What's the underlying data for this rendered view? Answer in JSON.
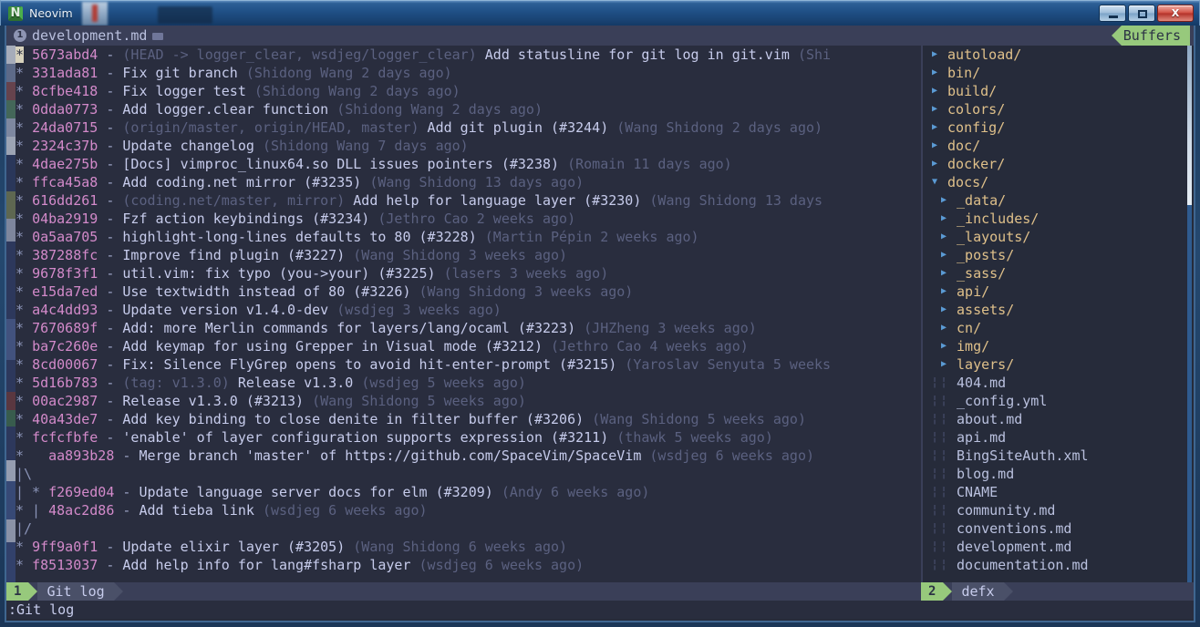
{
  "window": {
    "app_title": "Neovim",
    "app_icon": "neovim-logo-icon",
    "minimize_label": "minimize-icon",
    "maximize_label": "maximize-icon",
    "close_label": "X"
  },
  "tabline": {
    "tab_number": "1",
    "tab_name": "development.md",
    "modified_indicator": "modified-icon",
    "right_label": "Buffers"
  },
  "editor": {
    "lines": [
      {
        "graph": "* ",
        "hash": "5673abd4",
        "dash": " - ",
        "refs": "(HEAD -> logger_clear, wsdjeg/logger_clear) ",
        "subject": "Add statusline for git log in git.vim ",
        "meta": "(Shi",
        "cursor": true
      },
      {
        "graph": "* ",
        "hash": "331ada81",
        "dash": " - ",
        "refs": "",
        "subject": "Fix git branch ",
        "meta": "(Shidong Wang 2 days ago)"
      },
      {
        "graph": "* ",
        "hash": "8cfbe418",
        "dash": " - ",
        "refs": "",
        "subject": "Fix logger test ",
        "meta": "(Shidong Wang 2 days ago)"
      },
      {
        "graph": "* ",
        "hash": "0dda0773",
        "dash": " - ",
        "refs": "",
        "subject": "Add logger.clear function ",
        "meta": "(Shidong Wang 2 days ago)"
      },
      {
        "graph": "* ",
        "hash": "24da0715",
        "dash": " - ",
        "refs": "(origin/master, origin/HEAD, master) ",
        "subject": "Add git plugin (#3244) ",
        "meta": "(Wang Shidong 2 days ago)"
      },
      {
        "graph": "* ",
        "hash": "2324c37b",
        "dash": " - ",
        "refs": "",
        "subject": "Update changelog ",
        "meta": "(Shidong Wang 7 days ago)"
      },
      {
        "graph": "* ",
        "hash": "4dae275b",
        "dash": " - ",
        "refs": "",
        "subject": "[Docs] vimproc_linux64.so DLL issues pointers (#3238) ",
        "meta": "(Romain 11 days ago)"
      },
      {
        "graph": "* ",
        "hash": "ffca45a8",
        "dash": " - ",
        "refs": "",
        "subject": "Add coding.net mirror (#3235) ",
        "meta": "(Wang Shidong 13 days ago)"
      },
      {
        "graph": "* ",
        "hash": "616dd261",
        "dash": " - ",
        "refs": "(coding.net/master, mirror) ",
        "subject": "Add help for language layer (#3230) ",
        "meta": "(Wang Shidong 13 days"
      },
      {
        "graph": "* ",
        "hash": "04ba2919",
        "dash": " - ",
        "refs": "",
        "subject": "Fzf action keybindings (#3234) ",
        "meta": "(Jethro Cao 2 weeks ago)"
      },
      {
        "graph": "* ",
        "hash": "0a5aa705",
        "dash": " - ",
        "refs": "",
        "subject": "highlight-long-lines defaults to 80 (#3228) ",
        "meta": "(Martin Pépin 2 weeks ago)"
      },
      {
        "graph": "* ",
        "hash": "387288fc",
        "dash": " - ",
        "refs": "",
        "subject": "Improve find plugin (#3227) ",
        "meta": "(Wang Shidong 3 weeks ago)"
      },
      {
        "graph": "* ",
        "hash": "9678f3f1",
        "dash": " - ",
        "refs": "",
        "subject": "util.vim: fix typo (you->your) (#3225) ",
        "meta": "(lasers 3 weeks ago)"
      },
      {
        "graph": "* ",
        "hash": "e15da7ed",
        "dash": " - ",
        "refs": "",
        "subject": "Use textwidth instead of 80 (#3226) ",
        "meta": "(Wang Shidong 3 weeks ago)"
      },
      {
        "graph": "* ",
        "hash": "a4c4dd93",
        "dash": " - ",
        "refs": "",
        "subject": "Update version v1.4.0-dev ",
        "meta": "(wsdjeg 3 weeks ago)"
      },
      {
        "graph": "* ",
        "hash": "7670689f",
        "dash": " - ",
        "refs": "",
        "subject": "Add: more Merlin commands for layers/lang/ocaml (#3223) ",
        "meta": "(JHZheng 3 weeks ago)"
      },
      {
        "graph": "* ",
        "hash": "ba7c260e",
        "dash": " - ",
        "refs": "",
        "subject": "Add keymap for using Grepper in Visual mode (#3212) ",
        "meta": "(Jethro Cao 4 weeks ago)"
      },
      {
        "graph": "* ",
        "hash": "8cd00067",
        "dash": " - ",
        "refs": "",
        "subject": "Fix: Silence FlyGrep opens to avoid hit-enter-prompt (#3215) ",
        "meta": "(Yaroslav Senyuta 5 weeks"
      },
      {
        "graph": "* ",
        "hash": "5d16b783",
        "dash": " - ",
        "refs": "(tag: v1.3.0) ",
        "subject": "Release v1.3.0 ",
        "meta": "(wsdjeg 5 weeks ago)"
      },
      {
        "graph": "* ",
        "hash": "00ac2987",
        "dash": " - ",
        "refs": "",
        "subject": "Release v1.3.0 (#3213) ",
        "meta": "(Wang Shidong 5 weeks ago)"
      },
      {
        "graph": "* ",
        "hash": "40a43de7",
        "dash": " - ",
        "refs": "",
        "subject": "Add key binding to close denite in filter buffer (#3206) ",
        "meta": "(Wang Shidong 5 weeks ago)"
      },
      {
        "graph": "* ",
        "hash": "fcfcfbfe",
        "dash": " - ",
        "refs": "",
        "subject": "'enable' of layer configuration supports expression (#3211) ",
        "meta": "(thawk 5 weeks ago)"
      },
      {
        "graph": "*   ",
        "hash": "aa893b28",
        "dash": " - ",
        "refs": "",
        "subject": "Merge branch 'master' of https://github.com/SpaceVim/SpaceVim ",
        "meta": "(wsdjeg 6 weeks ago)"
      },
      {
        "graph": "|\\",
        "hash": "",
        "dash": "",
        "refs": "",
        "subject": "",
        "meta": ""
      },
      {
        "graph": "| * ",
        "hash": "f269ed04",
        "dash": " - ",
        "refs": "",
        "subject": "Update language server docs for elm (#3209) ",
        "meta": "(Andy 6 weeks ago)"
      },
      {
        "graph": "* | ",
        "hash": "48ac2d86",
        "dash": " - ",
        "refs": "",
        "subject": "Add tieba link ",
        "meta": "(wsdjeg 6 weeks ago)"
      },
      {
        "graph": "|/",
        "hash": "",
        "dash": "",
        "refs": "",
        "subject": "",
        "meta": ""
      },
      {
        "graph": "* ",
        "hash": "9ff9a0f1",
        "dash": " - ",
        "refs": "",
        "subject": "Update elixir layer (#3205) ",
        "meta": "(Wang Shidong 6 weeks ago)"
      },
      {
        "graph": "* ",
        "hash": "f8513037",
        "dash": " - ",
        "refs": "",
        "subject": "Add help info for lang#fsharp layer ",
        "meta": "(wsdjeg 6 weeks ago)"
      }
    ]
  },
  "filetree": {
    "items": [
      {
        "indent": 0,
        "type": "dir",
        "state": "closed",
        "name": "autoload/"
      },
      {
        "indent": 0,
        "type": "dir",
        "state": "closed",
        "name": "bin/"
      },
      {
        "indent": 0,
        "type": "dir",
        "state": "closed",
        "name": "build/"
      },
      {
        "indent": 0,
        "type": "dir",
        "state": "closed",
        "name": "colors/"
      },
      {
        "indent": 0,
        "type": "dir",
        "state": "closed",
        "name": "config/"
      },
      {
        "indent": 0,
        "type": "dir",
        "state": "closed",
        "name": "doc/"
      },
      {
        "indent": 0,
        "type": "dir",
        "state": "closed",
        "name": "docker/"
      },
      {
        "indent": 0,
        "type": "dir",
        "state": "open",
        "name": "docs/"
      },
      {
        "indent": 1,
        "type": "dir",
        "state": "closed",
        "name": "_data/"
      },
      {
        "indent": 1,
        "type": "dir",
        "state": "closed",
        "name": "_includes/"
      },
      {
        "indent": 1,
        "type": "dir",
        "state": "closed",
        "name": "_layouts/"
      },
      {
        "indent": 1,
        "type": "dir",
        "state": "closed",
        "name": "_posts/"
      },
      {
        "indent": 1,
        "type": "dir",
        "state": "closed",
        "name": "_sass/"
      },
      {
        "indent": 1,
        "type": "dir",
        "state": "closed",
        "name": "api/"
      },
      {
        "indent": 1,
        "type": "dir",
        "state": "closed",
        "name": "assets/"
      },
      {
        "indent": 1,
        "type": "dir",
        "state": "closed",
        "name": "cn/"
      },
      {
        "indent": 1,
        "type": "dir",
        "state": "closed",
        "name": "img/"
      },
      {
        "indent": 1,
        "type": "dir",
        "state": "closed",
        "name": "layers/"
      },
      {
        "indent": 1,
        "type": "file",
        "state": "",
        "name": "404.md"
      },
      {
        "indent": 1,
        "type": "file",
        "state": "",
        "name": "_config.yml"
      },
      {
        "indent": 1,
        "type": "file",
        "state": "",
        "name": "about.md"
      },
      {
        "indent": 1,
        "type": "file",
        "state": "",
        "name": "api.md"
      },
      {
        "indent": 1,
        "type": "file",
        "state": "",
        "name": "BingSiteAuth.xml"
      },
      {
        "indent": 1,
        "type": "file",
        "state": "",
        "name": "blog.md"
      },
      {
        "indent": 1,
        "type": "file",
        "state": "",
        "name": "CNAME"
      },
      {
        "indent": 1,
        "type": "file",
        "state": "",
        "name": "community.md"
      },
      {
        "indent": 1,
        "type": "file",
        "state": "",
        "name": "conventions.md"
      },
      {
        "indent": 1,
        "type": "file",
        "state": "",
        "name": "development.md"
      },
      {
        "indent": 1,
        "type": "file",
        "state": "",
        "name": "documentation.md"
      }
    ]
  },
  "statusline": {
    "left_window_number": "1",
    "left_name": "Git log",
    "right_window_number": "2",
    "right_name": "defx"
  },
  "cmdline": {
    "text": ":Git log"
  },
  "colors": {
    "background": "#292d3e",
    "hash": "#d38aca",
    "subject": "#c7ccec",
    "meta": "#5b6180",
    "dir": "#dfc08a",
    "file": "#b9c0de",
    "accent_green": "#97c97c",
    "statusline_bg": "#3a3f58",
    "triangle_blue": "#5b9bd5"
  }
}
